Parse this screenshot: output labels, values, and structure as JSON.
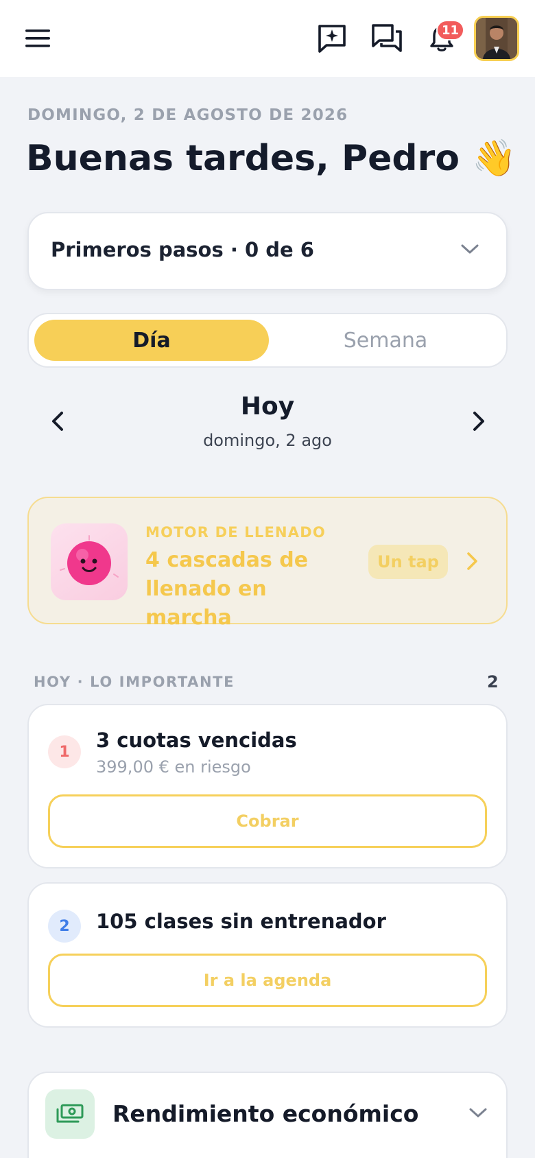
{
  "header": {
    "notification_count": "11",
    "avatar_alt": "Pedro"
  },
  "greeting": {
    "date": "DOMINGO, 2 DE AGOSTO DE 2026",
    "title": "Buenas tardes, Pedro 👋"
  },
  "onboarding": {
    "title": "Primeros pasos · 0 de 6"
  },
  "view_toggle": {
    "options": [
      "Día",
      "Semana"
    ],
    "selected": "Día"
  },
  "day_nav": {
    "title": "Hoy",
    "subtitle": "domingo, 2 ago"
  },
  "motor": {
    "kicker": "MOTOR DE LLENADO",
    "text": "4 cascadas de llenado en marcha",
    "chip": "Un tap"
  },
  "important": {
    "heading": "HOY · LO IMPORTANTE",
    "count": "2",
    "tasks": [
      {
        "number": "1",
        "title": "3 cuotas vencidas",
        "subtitle": "399,00 € en riesgo",
        "action": "Cobrar"
      },
      {
        "number": "2",
        "title": "105 clases sin entrenador",
        "action": "Ir a la agenda"
      }
    ]
  },
  "performance": {
    "title": "Rendimiento económico"
  },
  "colors": {
    "accent": "#f7cf57",
    "background": "#f1f3f7",
    "badge": "#f25c5c"
  }
}
